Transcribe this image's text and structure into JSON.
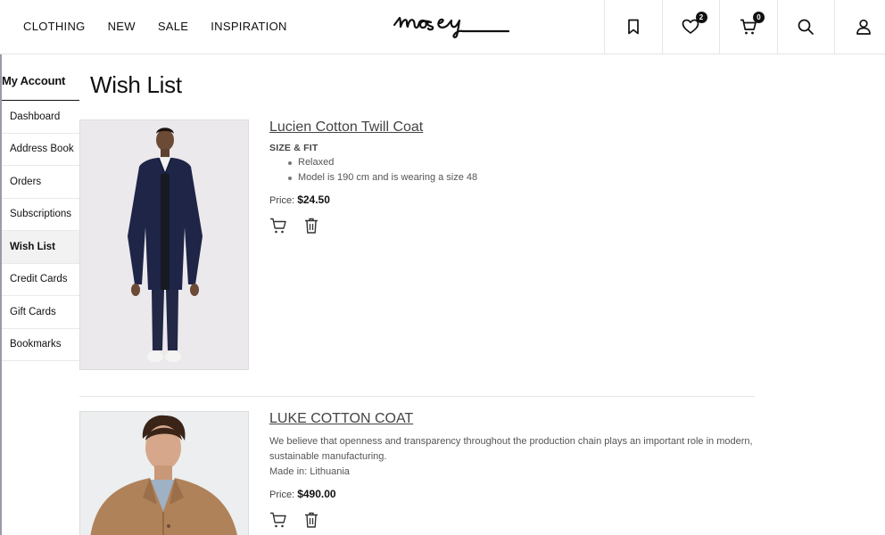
{
  "nav": {
    "items": [
      "CLOTHING",
      "NEW",
      "SALE",
      "INSPIRATION"
    ]
  },
  "logo": {
    "text": "mosey"
  },
  "header_icons": {
    "bookmark": "bookmark-icon",
    "wishlist": "heart-icon",
    "wishlist_count": "2",
    "cart": "cart-icon",
    "cart_count": "0",
    "search": "search-icon",
    "account": "user-icon"
  },
  "sidebar": {
    "title": "My Account",
    "items": [
      "Dashboard",
      "Address Book",
      "Orders",
      "Subscriptions",
      "Wish List",
      "Credit Cards",
      "Gift Cards",
      "Bookmarks"
    ],
    "active": "Wish List"
  },
  "page": {
    "title": "Wish List"
  },
  "products": [
    {
      "name": "Lucien Cotton Twill Coat",
      "size_heading": "SIZE & FIT",
      "bullets": [
        "Relaxed",
        "Model is 190 cm and is wearing a size 48"
      ],
      "price_label": "Price:",
      "price": "$24.50"
    },
    {
      "name": "LUKE COTTON COAT",
      "description": "We believe that openness and transparency throughout the production chain plays an important role in modern, sustainable manufacturing.",
      "made_in": "Made in: Lithuania",
      "price_label": "Price:",
      "price": "$490.00"
    }
  ],
  "colors": {
    "text": "#111111",
    "muted": "#555555",
    "coat_navy": "#1f2547",
    "coat_camel": "#b0825a",
    "badge": "#111111"
  }
}
